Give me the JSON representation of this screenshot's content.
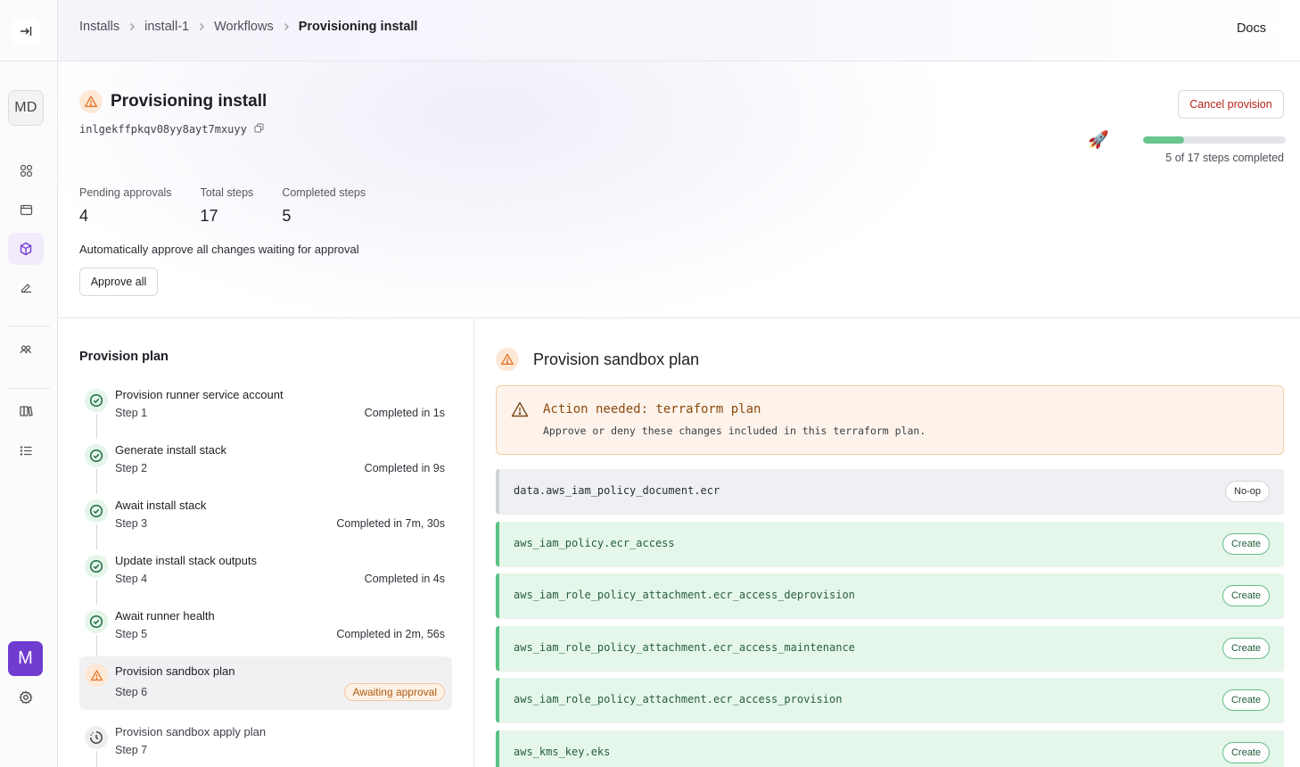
{
  "sidebar": {
    "avatar_initials": "MD",
    "org_initial": "M",
    "icons": [
      "dashboard-icon",
      "app-window-icon",
      "cube-icon",
      "stack-icon",
      "team-icon",
      "books-icon",
      "list-icon",
      "gear-icon"
    ]
  },
  "header": {
    "breadcrumbs": [
      "Installs",
      "install-1",
      "Workflows",
      "Provisioning install"
    ],
    "docs_label": "Docs"
  },
  "workflow": {
    "title": "Provisioning install",
    "id": "inlgekffpkqv08yy8ayt7mxuyy",
    "cancel_label": "Cancel provision",
    "progress_text": "5 of 17 steps completed",
    "progress_fraction": 0.29,
    "stats": [
      {
        "label": "Pending approvals",
        "value": "4"
      },
      {
        "label": "Total steps",
        "value": "17"
      },
      {
        "label": "Completed steps",
        "value": "5"
      }
    ],
    "auto_approve_text": "Automatically approve all changes waiting for approval",
    "approve_all_label": "Approve all"
  },
  "plan": {
    "title": "Provision plan",
    "steps": [
      {
        "name": "Provision runner service account",
        "step": "Step 1",
        "status": "Completed in 1s",
        "state": "done"
      },
      {
        "name": "Generate install stack",
        "step": "Step 2",
        "status": "Completed in 9s",
        "state": "done"
      },
      {
        "name": "Await install stack",
        "step": "Step 3",
        "status": "Completed in 7m, 30s",
        "state": "done"
      },
      {
        "name": "Update install stack outputs",
        "step": "Step 4",
        "status": "Completed in 4s",
        "state": "done"
      },
      {
        "name": "Await runner health",
        "step": "Step 5",
        "status": "Completed in 2m, 56s",
        "state": "done"
      },
      {
        "name": "Provision sandbox plan",
        "step": "Step 6",
        "status": "Awaiting approval",
        "state": "warn"
      },
      {
        "name": "Provision sandbox apply plan",
        "step": "Step 7",
        "status": "",
        "state": "pending"
      }
    ]
  },
  "detail": {
    "title": "Provision sandbox plan",
    "alert_title": "Action needed: terraform plan",
    "alert_desc": "Approve or deny these changes included in this terraform plan.",
    "resources": [
      {
        "name": "data.aws_iam_policy_document.ecr",
        "action": "No-op"
      },
      {
        "name": "aws_iam_policy.ecr_access",
        "action": "Create"
      },
      {
        "name": "aws_iam_role_policy_attachment.ecr_access_deprovision",
        "action": "Create"
      },
      {
        "name": "aws_iam_role_policy_attachment.ecr_access_maintenance",
        "action": "Create"
      },
      {
        "name": "aws_iam_role_policy_attachment.ecr_access_provision",
        "action": "Create"
      },
      {
        "name": "aws_kms_key.eks",
        "action": "Create"
      }
    ]
  }
}
